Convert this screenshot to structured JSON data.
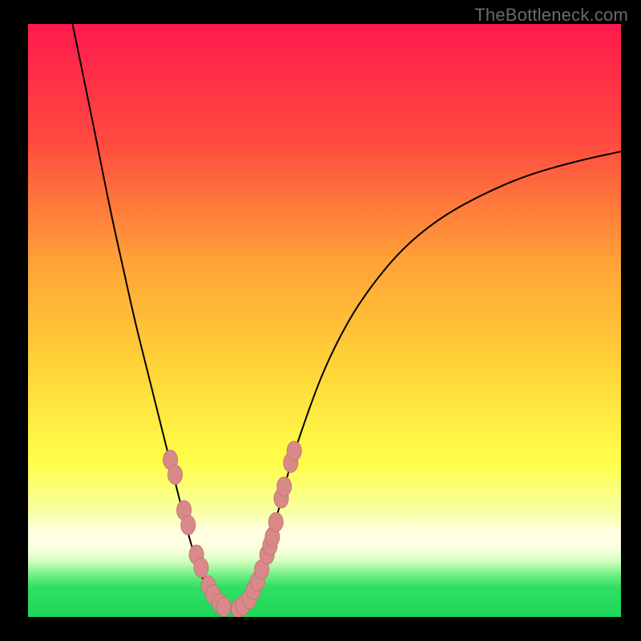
{
  "watermark": "TheBottleneck.com",
  "colors": {
    "black": "#000000",
    "curve": "#000000",
    "point_fill": "#d98a88",
    "point_stroke": "#c47775",
    "green_band": "#22dd55"
  },
  "chart_data": {
    "type": "line",
    "title": "",
    "xlabel": "",
    "ylabel": "",
    "xlim": [
      0,
      100
    ],
    "ylim": [
      0,
      100
    ],
    "background_gradient": [
      {
        "pos": 0.0,
        "color": "#ff1a4d"
      },
      {
        "pos": 0.2,
        "color": "#ff4b3f"
      },
      {
        "pos": 0.4,
        "color": "#ffa238"
      },
      {
        "pos": 0.58,
        "color": "#ffd438"
      },
      {
        "pos": 0.74,
        "color": "#ffff4a"
      },
      {
        "pos": 0.82,
        "color": "#f8ffa0"
      },
      {
        "pos": 0.86,
        "color": "#ffffe6"
      },
      {
        "pos": 0.885,
        "color": "#faffdd"
      },
      {
        "pos": 0.905,
        "color": "#d6ffc0"
      },
      {
        "pos": 0.92,
        "color": "#97f79b"
      },
      {
        "pos": 0.935,
        "color": "#5de97d"
      },
      {
        "pos": 0.95,
        "color": "#30df63"
      },
      {
        "pos": 1.0,
        "color": "#1dd858"
      }
    ],
    "series": [
      {
        "name": "left-branch",
        "x": [
          7.5,
          10,
          12,
          14,
          16,
          18,
          20,
          22,
          24,
          25.5,
          27,
          28.5,
          30,
          31.5
        ],
        "y": [
          100,
          88,
          78,
          68,
          59,
          50,
          42,
          34,
          26,
          20,
          14,
          9,
          5,
          2.5
        ]
      },
      {
        "name": "right-branch",
        "x": [
          37,
          38.5,
          40,
          42,
          44,
          47,
          50,
          54,
          58,
          63,
          69,
          76,
          84,
          93,
          100
        ],
        "y": [
          2.5,
          6,
          10,
          17,
          25,
          34,
          42,
          50,
          56,
          62,
          67,
          71,
          74.5,
          77,
          78.5
        ]
      },
      {
        "name": "valley-floor",
        "x": [
          31.5,
          33.5,
          35.5,
          37
        ],
        "y": [
          2.5,
          1.3,
          1.3,
          2.5
        ]
      }
    ],
    "points": {
      "name": "markers",
      "x": [
        24.0,
        24.8,
        26.3,
        27.0,
        28.4,
        29.2,
        30.4,
        31.2,
        32.3,
        33.0,
        35.5,
        36.2,
        37.3,
        38.0,
        38.7,
        39.4,
        40.3,
        40.8,
        41.2,
        41.8,
        42.7,
        43.2,
        44.3,
        44.9
      ],
      "y": [
        26.5,
        24.0,
        18.0,
        15.5,
        10.5,
        8.3,
        5.3,
        3.8,
        2.3,
        1.7,
        1.4,
        1.9,
        3.0,
        4.5,
        6.0,
        8.0,
        10.5,
        12.0,
        13.5,
        16.0,
        20.0,
        22.0,
        26.0,
        28.0
      ]
    }
  }
}
